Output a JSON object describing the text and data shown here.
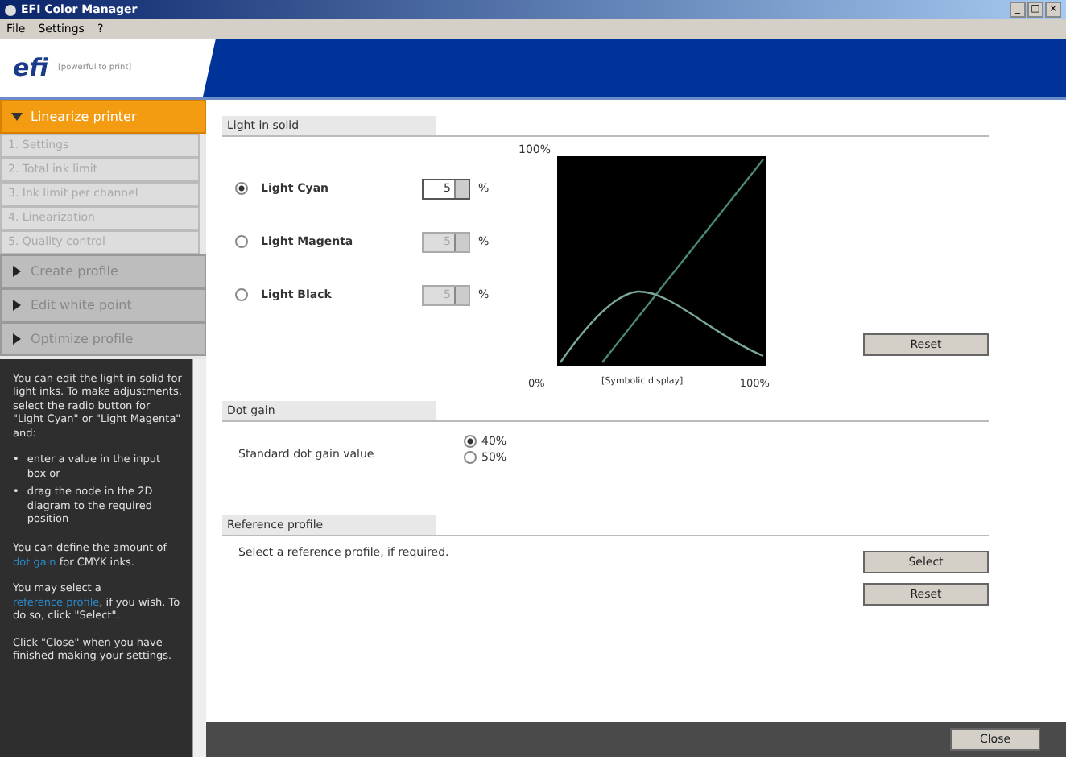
{
  "window": {
    "title": "EFI Color Manager",
    "controls": [
      "_",
      "□",
      "×"
    ]
  },
  "menu": [
    "File",
    "Settings",
    "?"
  ],
  "header": {
    "logo": "efi",
    "tagline": "[powerful to print]"
  },
  "sidebar": {
    "sections": [
      {
        "label": "Linearize printer",
        "expanded": true,
        "steps": [
          "1. Settings",
          "2. Total ink limit",
          "3. Ink limit per channel",
          "4. Linearization",
          "5. Quality control"
        ]
      },
      {
        "label": "Create profile",
        "expanded": false
      },
      {
        "label": "Edit white point",
        "expanded": false
      },
      {
        "label": "Optimize profile",
        "expanded": false
      }
    ]
  },
  "help": [
    {
      "kind": "p",
      "parts": [
        {
          "text": "You can edit the light in solid for light inks. To make adjustments, select the radio button for \"Light Cyan\" or \"Light Magenta\" and:"
        }
      ]
    },
    {
      "kind": "bullets",
      "marker": "•",
      "items": [
        "enter a value in the input box or",
        "drag the node in the 2D diagram to the required position"
      ]
    },
    {
      "kind": "p",
      "parts": [
        {
          "text": "You can define the amount of "
        },
        {
          "link": "dot gain"
        },
        {
          "text": " for CMYK inks."
        }
      ]
    },
    {
      "kind": "p",
      "parts": [
        {
          "text": "You may select a "
        },
        {
          "link": "reference profile"
        },
        {
          "text": ", if you wish. To do so, click \"Select\"."
        }
      ]
    },
    {
      "kind": "p",
      "parts": [
        {
          "text": "Click \"Close\" when you have finished making your settings."
        }
      ]
    }
  ],
  "light_in_solid": {
    "title": "Light in solid",
    "inks": [
      {
        "label": "Light Cyan",
        "selected": true,
        "value": "5",
        "unit": "%",
        "disabled": false
      },
      {
        "label": "Light Magenta",
        "selected": false,
        "value": "5",
        "unit": "%",
        "disabled": true
      },
      {
        "label": "Light Black",
        "selected": false,
        "value": "5",
        "unit": "%",
        "disabled": true
      }
    ],
    "diagram": {
      "top_label": "100%",
      "left_label": "0%",
      "caption": "[Symbolic display]",
      "right_label": "100%"
    },
    "reset_button": "Reset"
  },
  "dot_gain": {
    "title": "Dot gain",
    "label": "Standard dot gain value",
    "options": [
      {
        "label": "40%",
        "selected": true
      },
      {
        "label": "50%",
        "selected": false
      }
    ]
  },
  "reference_profile": {
    "title": "Reference profile",
    "text": "Select a reference profile, if required.",
    "buttons": [
      "Select",
      "Reset"
    ]
  },
  "close_button": "Close"
}
